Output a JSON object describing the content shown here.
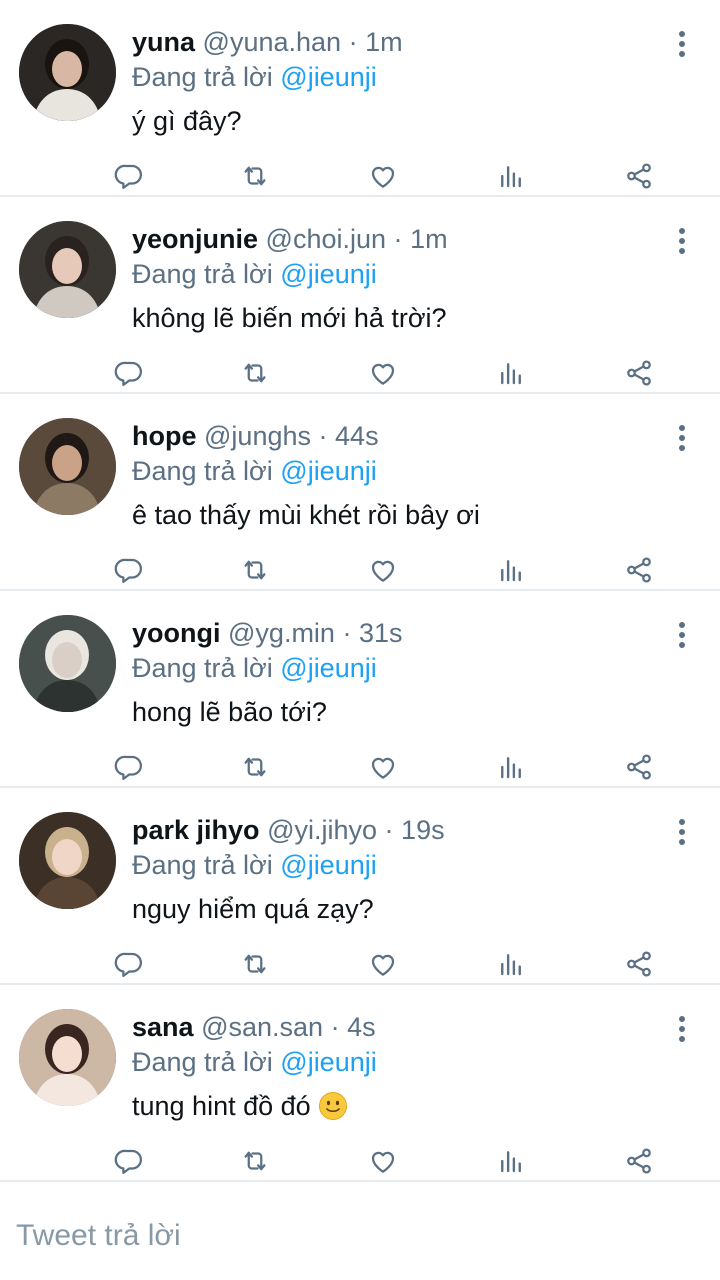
{
  "reply_prefix": "Đang trả lời",
  "colors": {
    "accent": "#1da1f2",
    "secondary_text": "#5b7083",
    "divider": "#e6ecf0"
  },
  "tweets": [
    {
      "name": "yuna",
      "handle": "@yuna.han",
      "dot": "·",
      "time": "1m",
      "mention": "@jieunji",
      "text": "ý gì đây?",
      "emoji": ""
    },
    {
      "name": "yeonjunie",
      "handle": "@choi.jun",
      "dot": "·",
      "time": "1m",
      "mention": "@jieunji",
      "text": "không lẽ biến mới hả trời?",
      "emoji": ""
    },
    {
      "name": "hope",
      "handle": "@junghs",
      "dot": "·",
      "time": "44s",
      "mention": "@jieunji",
      "text": "ê tao thấy mùi khét rồi bây ơi",
      "emoji": ""
    },
    {
      "name": "yoongi",
      "handle": "@yg.min",
      "dot": "·",
      "time": "31s",
      "mention": "@jieunji",
      "text": "hong lẽ bão tới?",
      "emoji": ""
    },
    {
      "name": "park jihyo",
      "handle": "@yi.jihyo",
      "dot": "·",
      "time": "19s",
      "mention": "@jieunji",
      "text": "nguy hiểm quá zạy?",
      "emoji": ""
    },
    {
      "name": "sana",
      "handle": "@san.san",
      "dot": "·",
      "time": "4s",
      "mention": "@jieunji",
      "text": "tung hint đồ đó",
      "emoji": "slightly-smiling-face"
    }
  ],
  "icons": [
    "reply-icon",
    "retweet-icon",
    "like-icon",
    "analytics-icon",
    "share-icon",
    "more-vertical-icon"
  ],
  "reply_box": {
    "placeholder": "Tweet trả lời"
  }
}
